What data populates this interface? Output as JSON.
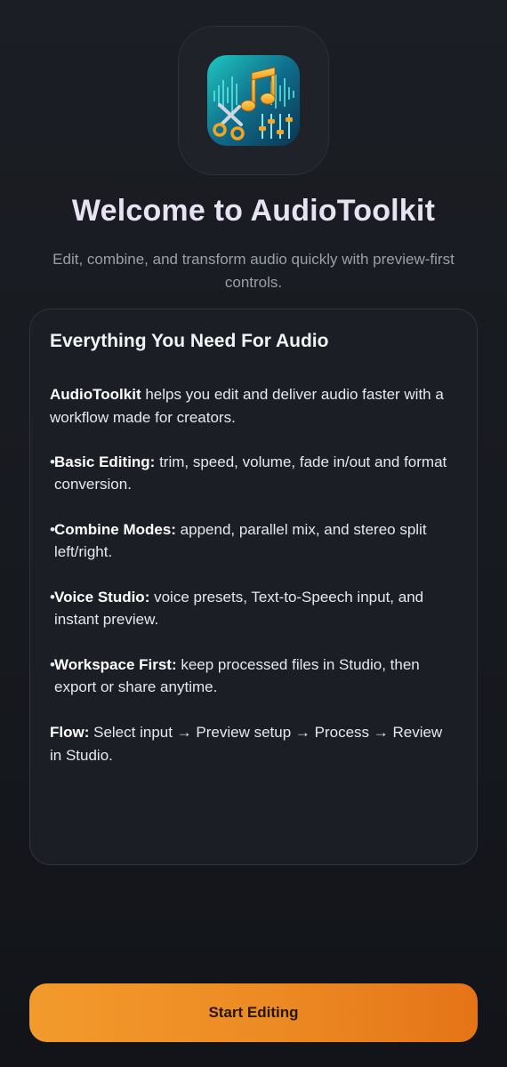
{
  "app": {
    "icon_name": "audio-toolkit-app-icon"
  },
  "welcome": {
    "title": "Welcome to AudioToolkit",
    "subtitle": "Edit, combine, and transform audio quickly with preview-first controls."
  },
  "card": {
    "title": "Everything You Need For Audio",
    "intro_strong": "AudioToolkit",
    "intro_rest": " helps you edit and deliver audio faster with a workflow made for creators.",
    "features": [
      {
        "bullet": "•",
        "label": "Basic Editing:",
        "text": " trim, speed, volume, fade in/out and format conversion."
      },
      {
        "bullet": "•",
        "label": "Combine Modes:",
        "text": " append, parallel mix, and stereo split left/right."
      },
      {
        "bullet": "•",
        "label": "Voice Studio:",
        "text": " voice presets, Text-to-Speech input, and instant preview."
      },
      {
        "bullet": "•",
        "label": "Workspace First:",
        "text": " keep processed files in Studio, then export or share anytime."
      }
    ],
    "flow_label": "Flow:",
    "flow_text": " Select input → Preview setup → Process → Review in Studio."
  },
  "cta": {
    "label": "Start Editing"
  },
  "colors": {
    "background": "#16191e",
    "card_background": "#1b1e24",
    "accent_start": "#f39a2c",
    "accent_end": "#e57417",
    "title_color": "#e8e3f3"
  }
}
